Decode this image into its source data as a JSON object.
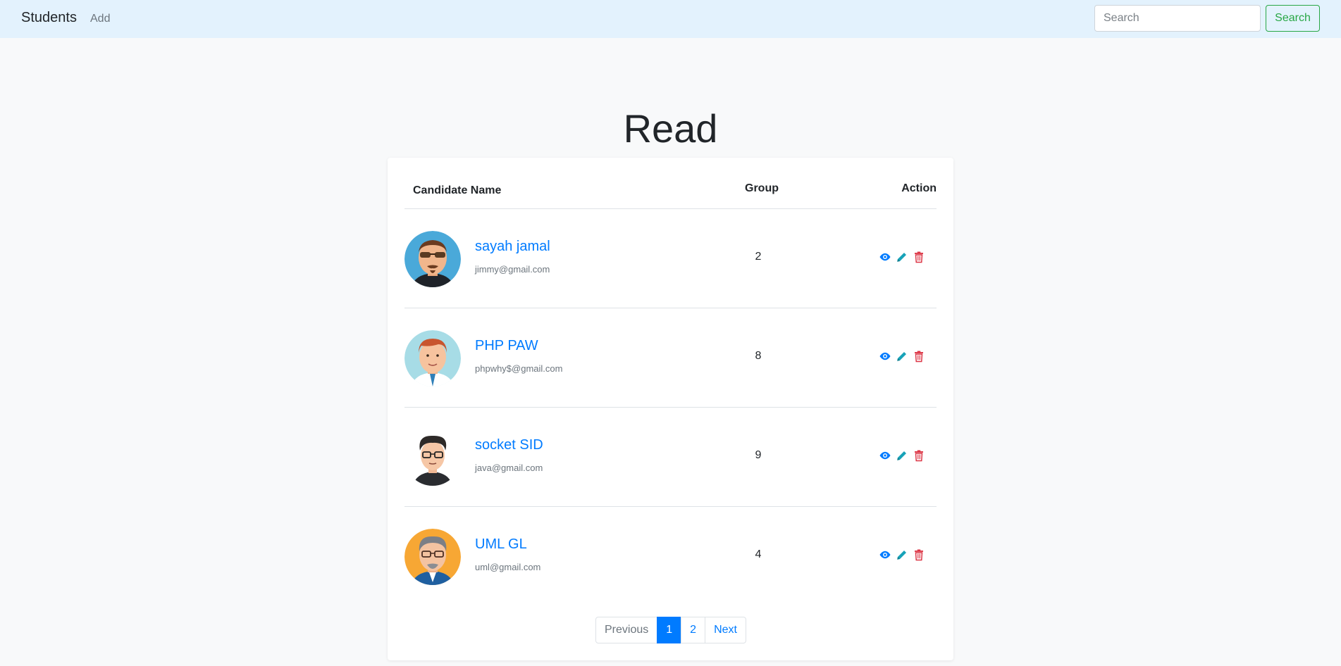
{
  "navbar": {
    "brand": "Students",
    "add_link": "Add",
    "search_placeholder": "Search",
    "search_button": "Search"
  },
  "page": {
    "title": "Read"
  },
  "table": {
    "headers": {
      "name": "Candidate Name",
      "group": "Group",
      "action": "Action"
    },
    "rows": [
      {
        "name": "sayah jamal",
        "email": "jimmy@gmail.com",
        "group": "2",
        "avatar": "avatar-sunglasses-man"
      },
      {
        "name": "PHP PAW",
        "email": "phpwhy$@gmail.com",
        "group": "8",
        "avatar": "avatar-redhair-man"
      },
      {
        "name": "socket SID",
        "email": "java@gmail.com",
        "group": "9",
        "avatar": "avatar-glasses-man"
      },
      {
        "name": "UML GL",
        "email": "uml@gmail.com",
        "group": "4",
        "avatar": "avatar-grayhair-man"
      }
    ],
    "action_icons": [
      "eye-icon",
      "pencil-icon",
      "trash-icon"
    ],
    "action_colors": {
      "view": "#007bff",
      "edit": "#17a2b8",
      "delete": "#dc3545"
    }
  },
  "pagination": {
    "previous": "Previous",
    "pages": [
      "1",
      "2"
    ],
    "active": "1",
    "next": "Next"
  },
  "colors": {
    "navbar_bg": "#e3f2fd",
    "link": "#007bff",
    "search_button": "#28a745"
  }
}
